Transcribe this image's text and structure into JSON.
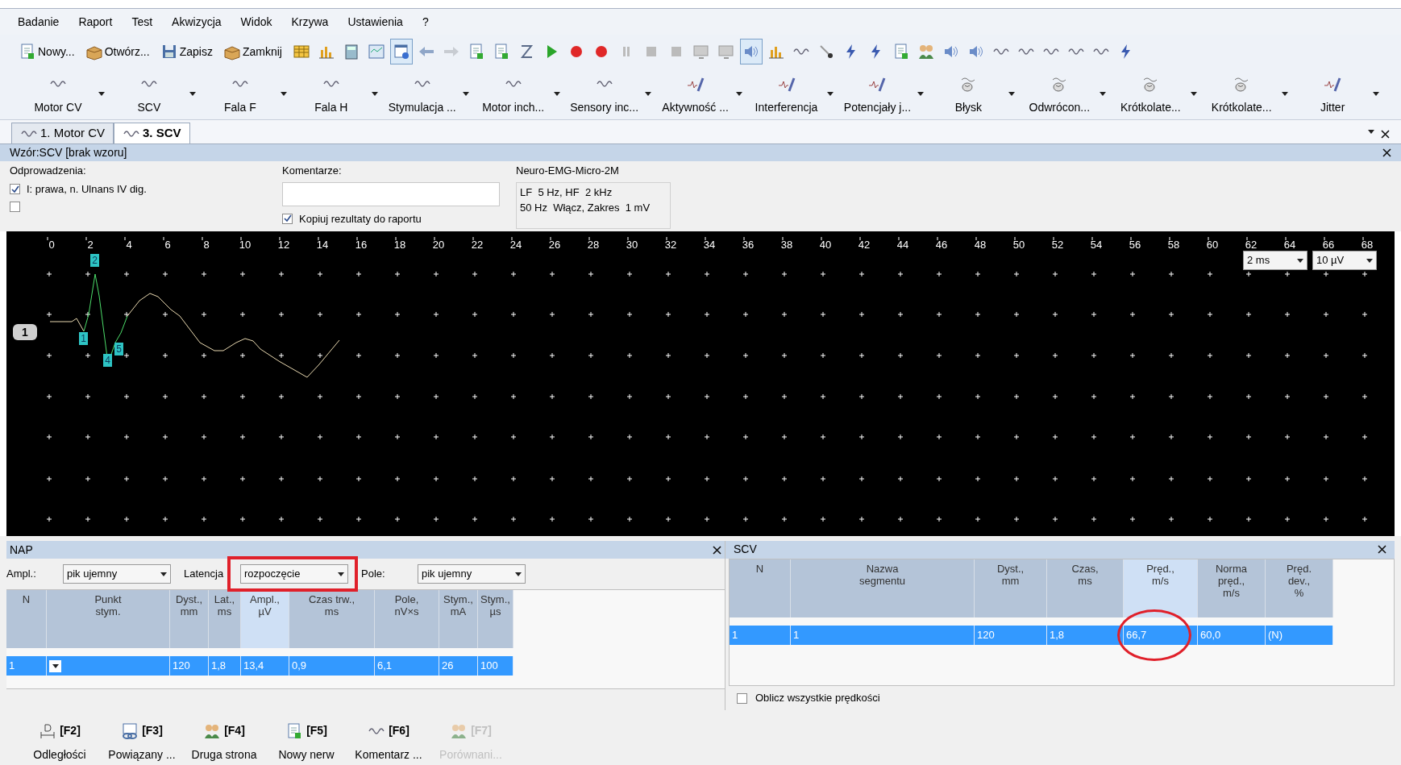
{
  "menu": [
    "Badanie",
    "Raport",
    "Test",
    "Akwizycja",
    "Widok",
    "Krzywa",
    "Ustawienia",
    "?"
  ],
  "toolbar": [
    {
      "kind": "doc",
      "label": "Nowy...",
      "pressed": false
    },
    {
      "kind": "box",
      "label": "Otwórz...",
      "pressed": false
    },
    {
      "kind": "disk",
      "label": "Zapisz",
      "pressed": false
    },
    {
      "kind": "box",
      "label": "Zamknij",
      "pressed": false
    },
    {
      "kind": "table",
      "pressed": false
    },
    {
      "kind": "bars",
      "pressed": false
    },
    {
      "kind": "calc",
      "pressed": false
    },
    {
      "kind": "chartwin",
      "pressed": false
    },
    {
      "kind": "window",
      "pressed": true
    },
    {
      "kind": "left",
      "pressed": false
    },
    {
      "kind": "right",
      "pressed": false
    },
    {
      "kind": "page",
      "pressed": false
    },
    {
      "kind": "page",
      "pressed": false
    },
    {
      "kind": "zed",
      "pressed": false
    },
    {
      "kind": "play",
      "pressed": false
    },
    {
      "kind": "record",
      "pressed": false
    },
    {
      "kind": "record",
      "pressed": false
    },
    {
      "kind": "pause",
      "pressed": false
    },
    {
      "kind": "stop",
      "pressed": false
    },
    {
      "kind": "stop",
      "pressed": false
    },
    {
      "kind": "monitor",
      "pressed": false
    },
    {
      "kind": "monitor",
      "pressed": false
    },
    {
      "kind": "speaker",
      "pressed": true
    },
    {
      "kind": "bars",
      "pressed": false
    },
    {
      "kind": "wave",
      "pressed": false
    },
    {
      "kind": "pin",
      "pressed": false
    },
    {
      "kind": "flash",
      "pressed": false
    },
    {
      "kind": "flash",
      "pressed": false
    },
    {
      "kind": "page",
      "pressed": false
    },
    {
      "kind": "people",
      "pressed": false
    },
    {
      "kind": "speaker",
      "pressed": false
    },
    {
      "kind": "speaker",
      "pressed": false
    },
    {
      "kind": "wave",
      "pressed": false
    },
    {
      "kind": "wave",
      "pressed": false
    },
    {
      "kind": "wave",
      "pressed": false
    },
    {
      "kind": "wave",
      "pressed": false
    },
    {
      "kind": "wave",
      "pressed": false
    },
    {
      "kind": "flash",
      "pressed": false
    }
  ],
  "modes": [
    {
      "label": "Motor CV",
      "kind": "wave"
    },
    {
      "label": "SCV",
      "kind": "wave"
    },
    {
      "label": "Fala F",
      "kind": "wave"
    },
    {
      "label": "Fala H",
      "kind": "wave"
    },
    {
      "label": "Stymulacja ...",
      "kind": "wave"
    },
    {
      "label": "Motor inch...",
      "kind": "wave"
    },
    {
      "label": "Sensory inc...",
      "kind": "wave"
    },
    {
      "label": "Aktywność ...",
      "kind": "needle"
    },
    {
      "label": "Interferencja",
      "kind": "needle"
    },
    {
      "label": "Potencjały j...",
      "kind": "needle"
    },
    {
      "label": "Błysk",
      "kind": "brain"
    },
    {
      "label": "Odwrócon...",
      "kind": "brain"
    },
    {
      "label": "Krótkolate...",
      "kind": "brain"
    },
    {
      "label": "Krótkolate...",
      "kind": "brain"
    },
    {
      "label": "Jitter",
      "kind": "needle"
    }
  ],
  "tabs": [
    {
      "label": "1. Motor CV",
      "selected": false
    },
    {
      "label": "3. SCV",
      "selected": true
    }
  ],
  "pattern_header": "Wzór:SCV [brak wzoru]",
  "leads": {
    "label": "Odprowadzenia:",
    "items": [
      {
        "label": "I: prawa, n. Ulnans IV dig.",
        "checked": true
      },
      {
        "checked": false
      }
    ]
  },
  "comments": {
    "label": "Komentarze:",
    "copy": {
      "label": "Kopiuj rezultaty do raportu",
      "checked": true
    }
  },
  "device": {
    "name": "Neuro-EMG-Micro-2M",
    "lines": [
      "LF  5 Hz, HF  2 kHz",
      "50 Hz  Włącz, Zakres  1 mV"
    ]
  },
  "graph": {
    "xticks": [
      "0",
      "2",
      "4",
      "6",
      "8",
      "10",
      "12",
      "14",
      "16",
      "18",
      "20",
      "22",
      "24",
      "26",
      "28",
      "30",
      "32",
      "34",
      "36",
      "38",
      "40",
      "42",
      "44",
      "46",
      "48",
      "50",
      "52",
      "54",
      "56",
      "58",
      "60",
      "62",
      "64",
      "66",
      "68"
    ],
    "timebase": "2 ms",
    "gain": "10 µV",
    "channel": "1",
    "markers": [
      "2",
      "1",
      "4",
      "5"
    ]
  },
  "nap": {
    "title": "NAP",
    "controls": [
      {
        "label": "Ampl.:",
        "value": "pik ujemny",
        "highlighted": false
      },
      {
        "label": "Latencja",
        "value": "rozpoczęcie",
        "highlighted": true
      },
      {
        "label": "Pole:",
        "value": "pik ujemny",
        "highlighted": false
      }
    ],
    "columns": [
      {
        "label": "N",
        "sorted": false
      },
      {
        "label": "Punkt\nstym.",
        "sorted": false
      },
      {
        "label": "Dyst.,\nmm",
        "sorted": false
      },
      {
        "label": "Lat.,\nms",
        "sorted": false
      },
      {
        "label": "Ampl.,\nµV",
        "sorted": true
      },
      {
        "label": "Czas trw.,\nms",
        "sorted": false
      },
      {
        "label": "Pole,\nnV×s",
        "sorted": false
      },
      {
        "label": "Stym.,\nmA",
        "sorted": false
      },
      {
        "label": "Stym.,\nµs",
        "sorted": false
      }
    ],
    "rows": [
      {
        "selected": true,
        "cells": [
          "1",
          "",
          "120",
          "1,8",
          "13,4",
          "0,9",
          "6,1",
          "26",
          "100"
        ]
      }
    ]
  },
  "scv": {
    "title": "SCV",
    "columns": [
      {
        "label": "N",
        "sorted": false,
        "circled": false
      },
      {
        "label": "Nazwa\nsegmentu",
        "sorted": false,
        "circled": false
      },
      {
        "label": "Dyst.,\nmm",
        "sorted": false,
        "circled": false
      },
      {
        "label": "Czas,\nms",
        "sorted": false,
        "circled": false
      },
      {
        "label": "Pręd.,\nm/s",
        "sorted": true,
        "circled": true
      },
      {
        "label": "Norma\npręd.,\nm/s",
        "sorted": false,
        "circled": false
      },
      {
        "label": "Pręd.\ndev.,\n%",
        "sorted": false,
        "circled": false
      }
    ],
    "rows": [
      {
        "selected": true,
        "cells": [
          "1",
          "1",
          "120",
          "1,8",
          "66,7",
          "60,0",
          "(N)"
        ]
      }
    ],
    "calc_all": {
      "label": "Oblicz wszystkie prędkości",
      "checked": false
    }
  },
  "actions": [
    {
      "key": "[F2]",
      "label": "Odległości",
      "kind": "ruler",
      "disabled": false
    },
    {
      "key": "[F3]",
      "label": "Powiązany ...",
      "kind": "link",
      "disabled": false
    },
    {
      "key": "[F4]",
      "label": "Druga strona",
      "kind": "people",
      "disabled": false
    },
    {
      "key": "[F5]",
      "label": "Nowy nerw",
      "kind": "page",
      "disabled": false
    },
    {
      "key": "[F6]",
      "label": "Komentarz ...",
      "kind": "wave",
      "disabled": false
    },
    {
      "key": "[F7]",
      "label": "Porównani...",
      "kind": "people",
      "disabled": true
    }
  ]
}
